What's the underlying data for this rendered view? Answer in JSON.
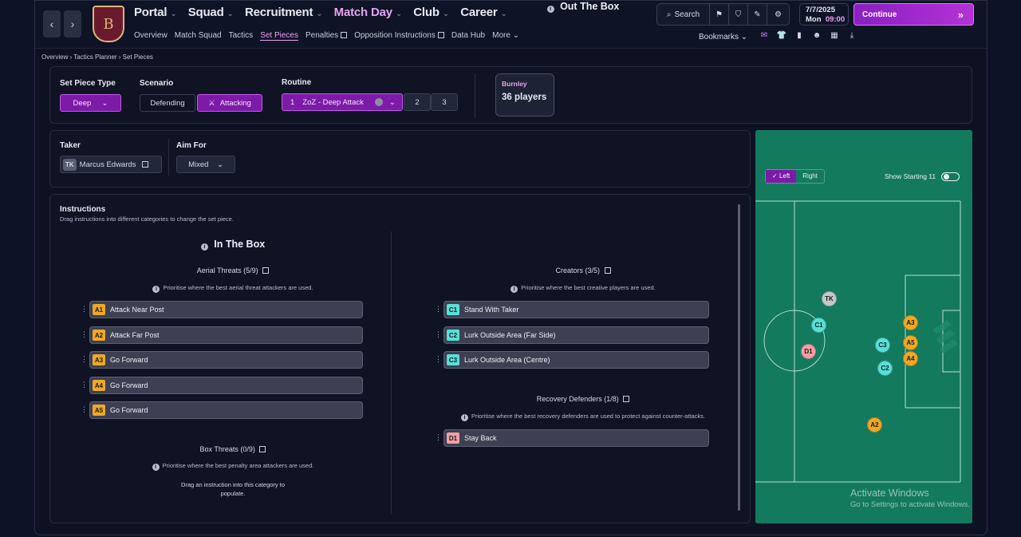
{
  "topbar": {
    "back_label": "‹",
    "forward_label": "›",
    "crest_letter": "B",
    "main_nav": [
      {
        "label": "Portal",
        "active": false
      },
      {
        "label": "Squad",
        "active": false
      },
      {
        "label": "Recruitment",
        "active": false
      },
      {
        "label": "Match Day",
        "active": true
      },
      {
        "label": "Club",
        "active": false
      },
      {
        "label": "Career",
        "active": false
      }
    ],
    "sub_nav": {
      "overview": "Overview",
      "match_squad": "Match Squad",
      "tactics": "Tactics",
      "set_pieces": "Set Pieces",
      "penalties": "Penalties",
      "opposition": "Opposition Instructions",
      "data_hub": "Data Hub",
      "more": "More"
    },
    "search_label": "Search",
    "date": "7/7/2025",
    "day": "Mon",
    "time": "09:00",
    "continue_label": "Continue",
    "bookmarks_label": "Bookmarks"
  },
  "breadcrumb": "Overview  ›  Tactics Planner  ›  Set Pieces",
  "setup": {
    "set_piece_type_label": "Set Piece Type",
    "set_piece_type_value": "Deep",
    "scenario_label": "Scenario",
    "scenario_defending": "Defending",
    "scenario_attacking": "Attacking",
    "routine_label": "Routine",
    "routine_num": "1",
    "routine_name": "ZoZ - Deep Attack",
    "routine_2": "2",
    "routine_3": "3",
    "club_name": "Burnley",
    "club_players": "36 players"
  },
  "taker": {
    "taker_label": "Taker",
    "taker_badge": "TK",
    "taker_name": "Marcus Edwards",
    "aim_label": "Aim For",
    "aim_value": "Mixed"
  },
  "instructions": {
    "title": "Instructions",
    "subtitle": "Drag instructions into different categories to change the set piece.",
    "in_box": {
      "title": "In The Box",
      "aerial_title": "Aerial Threats (5/9)",
      "aerial_hint": "Prioritise where the best aerial threat attackers are used.",
      "aerial_rows": [
        {
          "tag": "A1",
          "label": "Attack Near Post"
        },
        {
          "tag": "A2",
          "label": "Attack Far Post"
        },
        {
          "tag": "A3",
          "label": "Go Forward"
        },
        {
          "tag": "A4",
          "label": "Go Forward"
        },
        {
          "tag": "A5",
          "label": "Go Forward"
        }
      ],
      "box_title": "Box Threats (0/9)",
      "box_hint": "Prioritise where the best penalty area attackers are used.",
      "box_empty_1": "Drag an instruction into this category to",
      "box_empty_2": "populate."
    },
    "out_box": {
      "title": "Out The Box",
      "creators_title": "Creators (3/5)",
      "creators_hint": "Prioritise where the best creative players are used.",
      "creators_rows": [
        {
          "tag": "C1",
          "label": "Stand With Taker"
        },
        {
          "tag": "C2",
          "label": "Lurk Outside Area (Far Side)"
        },
        {
          "tag": "C3",
          "label": "Lurk Outside Area (Centre)"
        }
      ],
      "recovery_title": "Recovery Defenders (1/8)",
      "recovery_hint": "Prioritise where the best recovery defenders are used to protect against counter-attacks.",
      "recovery_rows": [
        {
          "tag": "D1",
          "label": "Stay Back"
        }
      ]
    }
  },
  "pitch": {
    "left_label": "Left",
    "right_label": "Right",
    "show_starting_label": "Show Starting 11",
    "markers": [
      {
        "tag": "TK"
      },
      {
        "tag": "C1"
      },
      {
        "tag": "D1"
      },
      {
        "tag": "C3"
      },
      {
        "tag": "C2"
      },
      {
        "tag": "A3"
      },
      {
        "tag": "A5"
      },
      {
        "tag": "A4"
      },
      {
        "tag": "A2"
      }
    ]
  },
  "watermark": {
    "line1": "Activate Windows",
    "line2": "Go to Settings to activate Windows."
  },
  "colors": {
    "accent_purple": "#7d1ba8",
    "active_pink": "#e7a3f2",
    "aerial_tag": "#f0a825",
    "creator_tag": "#58e0d8",
    "defender_tag": "#f2a0a0",
    "taker_tag": "#c8c8c8",
    "pitch_green": "#137a5e"
  }
}
